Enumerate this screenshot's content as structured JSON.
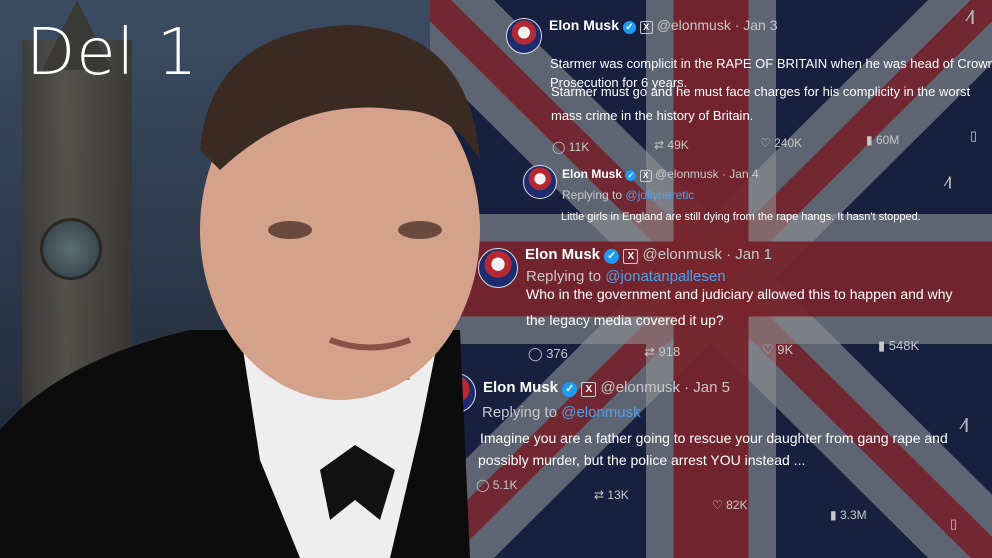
{
  "title": "Del 1",
  "tweets": [
    {
      "name": "Elon Musk",
      "handle": "@elonmusk",
      "date": "· Jan 3",
      "lines": [
        "Starmer was complicit in the RAPE OF BRITAIN when he was head of Crown",
        "Prosecution for 6 years.",
        "",
        "Starmer must go and he must face charges for his complicity in the worst",
        "mass crime in the history of Britain."
      ],
      "replies": "11K",
      "reposts": "49K",
      "likes": "240K",
      "views": "60M"
    },
    {
      "name": "Elon Musk",
      "handle": "@elonmusk",
      "date": "· Jan 4",
      "replying_prefix": "Replying to",
      "replying_to": "@jollyheretic",
      "lines": [
        "Little girls in England are still dying from the rape hangs. It hasn't stopped."
      ]
    },
    {
      "name": "Elon Musk",
      "handle": "@elonmusk",
      "date": "· Jan 1",
      "replying_prefix": "Replying to",
      "replying_to": "@jonatanpallesen",
      "lines": [
        "Who in the government and judiciary allowed this to happen and why",
        "the legacy media covered it up?"
      ],
      "replies": "376",
      "reposts": "918",
      "likes": "9K",
      "views": "548K"
    },
    {
      "name": "Elon Musk",
      "handle": "@elonmusk",
      "date": "· Jan 5",
      "replying_prefix": "Replying to",
      "replying_to": "@elonmusk",
      "lines": [
        "Imagine you are a father going to rescue your daughter from gang rape and",
        "possibly murder, but the police arrest YOU instead ..."
      ],
      "replies": "5.1K",
      "reposts": "13K",
      "likes": "82K",
      "views": "3.3M"
    }
  ],
  "icons": {
    "reply": "reply-icon",
    "repost": "repost-icon",
    "like": "heart-icon",
    "views": "views-icon",
    "bookmark": "bookmark-icon",
    "grok": "grok-icon",
    "verified": "verified-badge-icon"
  },
  "colors": {
    "verified": "#1d9bf0",
    "link": "#4aa3f0",
    "flag_blue": "#1f2b55",
    "flag_red": "#b0202a"
  }
}
